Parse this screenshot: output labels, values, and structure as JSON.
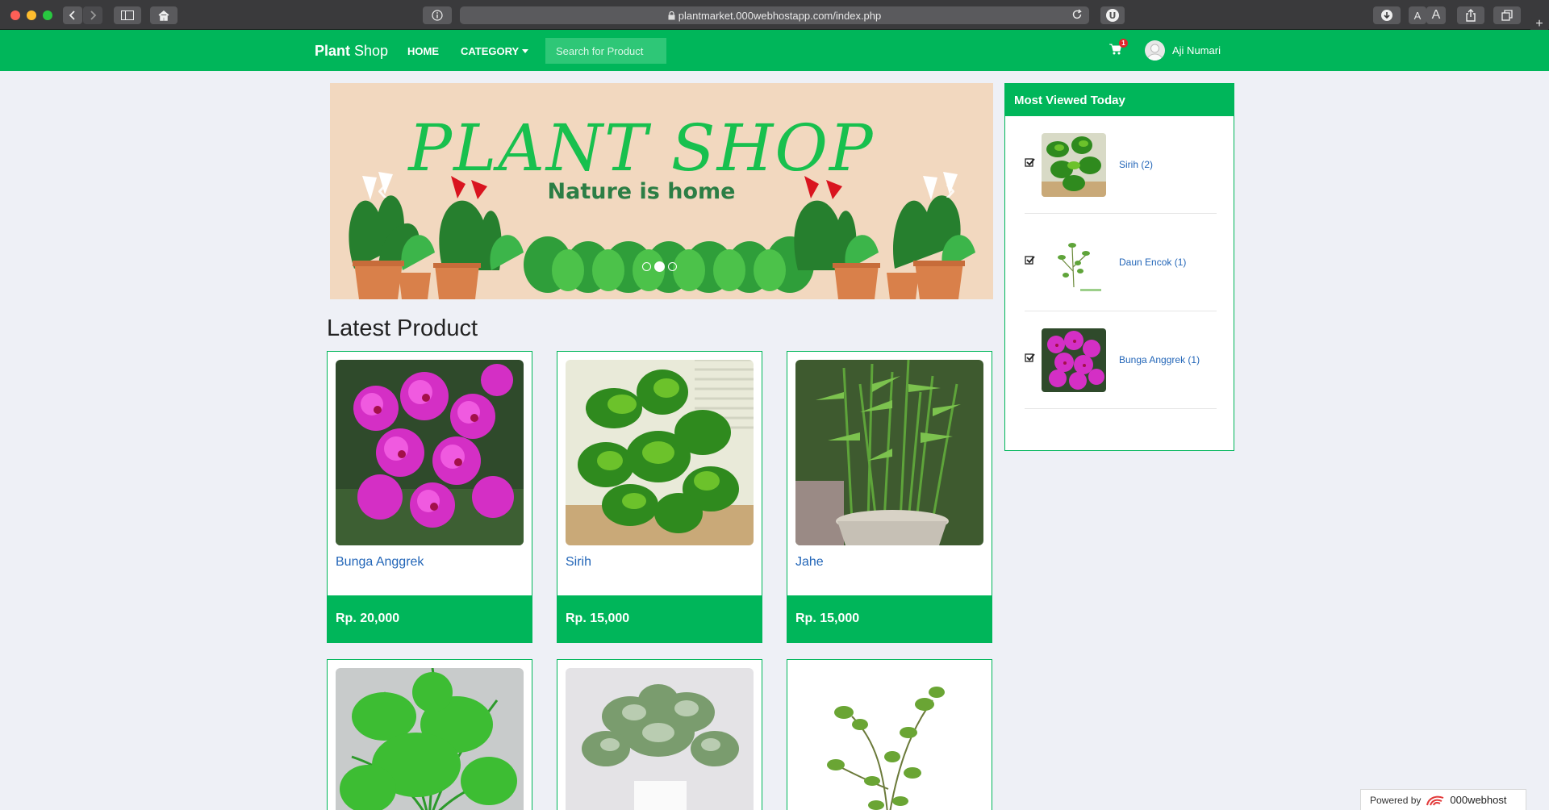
{
  "browser": {
    "url": "plantmarket.000webhostapp.com/index.php",
    "font_small": "A",
    "font_large": "A"
  },
  "navbar": {
    "brand_bold": "Plant",
    "brand_rest": " Shop",
    "home": "HOME",
    "category": "CATEGORY",
    "search_placeholder": "Search for Product",
    "cart_count": "1",
    "username": "Aji Numari"
  },
  "hero": {
    "title": "PLANT SHOP",
    "subtitle": "Nature is home",
    "prev": "‹",
    "next": "›",
    "slide_count": 3,
    "active_slide": 2
  },
  "latest": {
    "title": "Latest Product",
    "products": [
      {
        "name": "Bunga Anggrek",
        "price": "Rp. 20,000"
      },
      {
        "name": "Sirih",
        "price": "Rp. 15,000"
      },
      {
        "name": "Jahe",
        "price": "Rp. 15,000"
      }
    ]
  },
  "most_viewed": {
    "title": "Most Viewed Today",
    "items": [
      {
        "label": "Sirih (2)"
      },
      {
        "label": "Daun Encok (1)"
      },
      {
        "label": "Bunga Anggrek (1)"
      }
    ]
  },
  "footer": {
    "powered_by": "Powered by",
    "host": "000webhost"
  }
}
